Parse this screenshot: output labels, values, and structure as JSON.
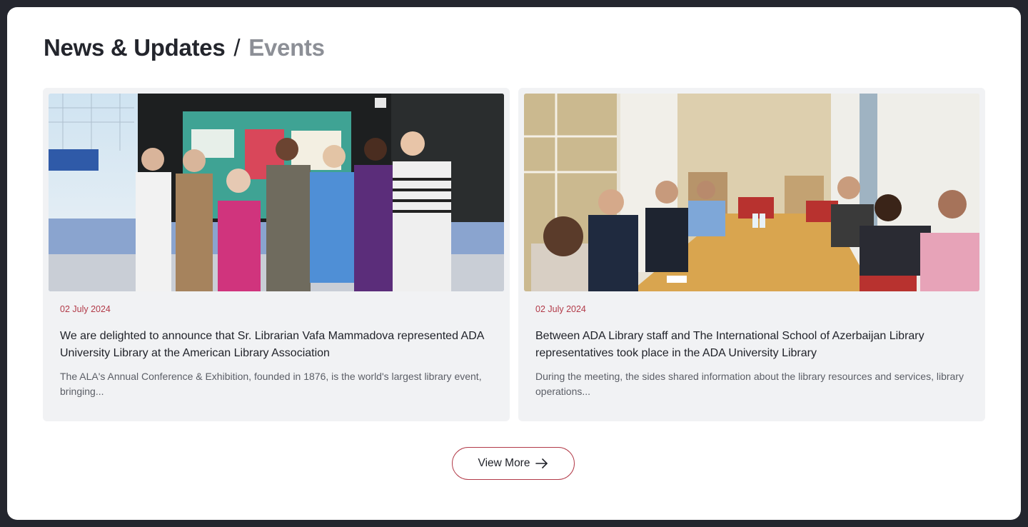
{
  "section": {
    "title": "News & Updates",
    "separator": "/",
    "subtitle": "Events"
  },
  "cards": [
    {
      "date": "02 July 2024",
      "title": "We are delighted to announce that Sr. Librarian Vafa Mammadova represented ADA University Library at the American Library Association",
      "excerpt": "The ALA's Annual Conference & Exhibition, founded in 1876, is the world's largest library event, bringing..."
    },
    {
      "date": "02 July 2024",
      "title": "Between ADA Library staff and The International School of Azerbaijan Library representatives took place in the ADA University Library",
      "excerpt": "During the meeting, the sides shared information about the library resources and services, library operations..."
    }
  ],
  "view_more": {
    "label": "View More",
    "icon": "arrow-right-icon"
  },
  "colors": {
    "accent": "#b23a48",
    "card_background": "#f1f2f4",
    "heading": "#23252c",
    "heading_muted": "#8c8f96"
  }
}
